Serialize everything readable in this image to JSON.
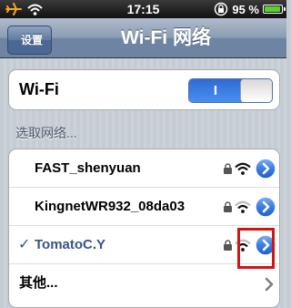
{
  "status_bar": {
    "time": "17:15",
    "battery_percent": "95 %",
    "battery_level": 0.95,
    "icons": [
      "airplane-mode-icon",
      "wifi-signal-icon",
      "orientation-lock-icon",
      "battery-icon"
    ]
  },
  "nav": {
    "back_label": "设置",
    "title": "Wi-Fi 网络"
  },
  "wifi": {
    "label": "Wi-Fi",
    "toggle_on_text": "I",
    "enabled": true
  },
  "section_header": "选取网络...",
  "networks": [
    {
      "name": "FAST_shenyuan",
      "locked": true,
      "selected": false,
      "icons": [
        "lock-icon",
        "wifi-strength-icon",
        "detail-disclosure-icon"
      ]
    },
    {
      "name": "KingnetWR932_08da03",
      "locked": true,
      "selected": false,
      "icons": [
        "lock-icon",
        "wifi-strength-icon",
        "detail-disclosure-icon"
      ]
    },
    {
      "name": "TomatoC.Y",
      "locked": true,
      "selected": true,
      "check": "✓",
      "icons": [
        "check-icon",
        "lock-icon",
        "wifi-strength-icon",
        "detail-disclosure-icon"
      ]
    }
  ],
  "other_label": "其他...",
  "colors": {
    "nav_bar": "#6d84a2",
    "selected_text": "#385487",
    "detail_button": "#2f6fd6",
    "toggle_on": "#2e6bd0",
    "highlight": "#d01515"
  }
}
